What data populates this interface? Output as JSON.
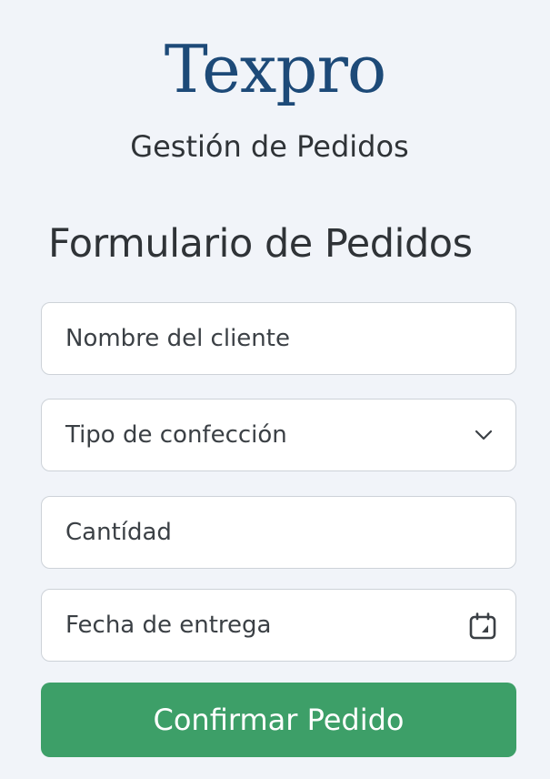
{
  "brand": {
    "name": "Texpro",
    "tagline": "Gestión de Pedidos"
  },
  "form": {
    "title": "Formulario de Pedidos",
    "fields": {
      "client_name": {
        "placeholder": "Nombre del cliente",
        "value": ""
      },
      "garment_type": {
        "selected": "Tipo de confección",
        "icon": "chevron-down-icon"
      },
      "quantity": {
        "placeholder": "Cantídad",
        "value": ""
      },
      "delivery_date": {
        "placeholder": "Fecha de entrega",
        "value": "",
        "icon": "calendar-icon"
      }
    },
    "submit_label": "Confirmar Pedido"
  },
  "colors": {
    "background": "#f1f4f9",
    "brand": "#1d4a78",
    "heading_text": "#2f3337",
    "field_border": "#cdd2d8",
    "primary_button": "#3d9f68"
  }
}
